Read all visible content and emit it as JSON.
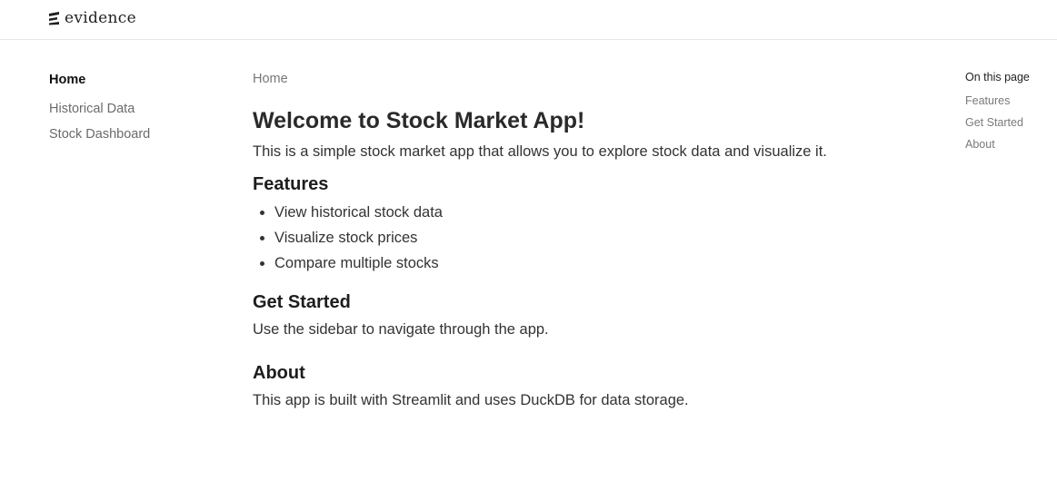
{
  "brand": {
    "logo_text": "evidence",
    "logo_icon": "evidence-logo-icon"
  },
  "sidebar": {
    "items": [
      {
        "label": "Home",
        "active": true
      },
      {
        "label": "Historical Data",
        "active": false
      },
      {
        "label": "Stock Dashboard",
        "active": false
      }
    ]
  },
  "breadcrumb": {
    "items": [
      "Home"
    ]
  },
  "content": {
    "title": "Welcome to Stock Market App!",
    "intro": "This is a simple stock market app that allows you to explore stock data and visualize it.",
    "features": {
      "heading": "Features",
      "items": [
        "View historical stock data",
        "Visualize stock prices",
        "Compare multiple stocks"
      ]
    },
    "get_started": {
      "heading": "Get Started",
      "text": "Use the sidebar to navigate through the app."
    },
    "about": {
      "heading": "About",
      "text": "This app is built with Streamlit and uses DuckDB for data storage."
    }
  },
  "toc": {
    "title": "On this page",
    "items": [
      "Features",
      "Get Started",
      "About"
    ]
  },
  "colors": {
    "text_primary": "#2d2d2d",
    "text_muted": "#6b6b6b",
    "border": "#e7e7e7",
    "background": "#ffffff"
  }
}
